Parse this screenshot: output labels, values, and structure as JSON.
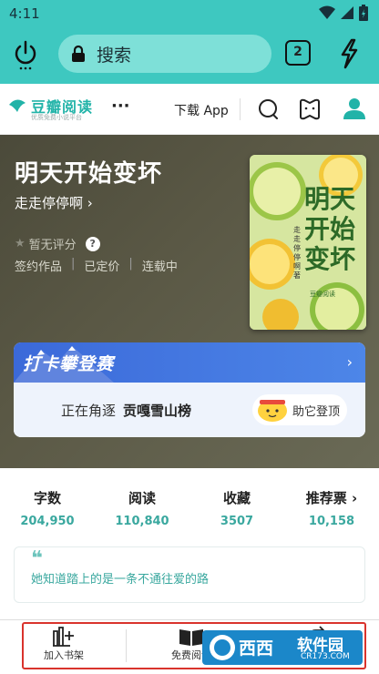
{
  "status": {
    "time": "4:11"
  },
  "browser": {
    "search_placeholder": "搜索",
    "tab_count": "2"
  },
  "site": {
    "logo_name": "豆瓣阅读",
    "logo_sub": "优质免费小说平台",
    "more": "···",
    "download": "下载 App"
  },
  "book": {
    "title": "明天开始变坏",
    "author": "走走停停啊 ›",
    "rating": "暂无评分",
    "tags": [
      "签约作品",
      "已定价",
      "连载中"
    ],
    "cover": {
      "title": "明天开始变坏",
      "author": "走走停停啊 著",
      "brand": "豆瓣阅读"
    }
  },
  "checkin": {
    "banner": "打卡攀登赛",
    "prefix": "正在角逐",
    "rank": "贡嘎雪山榜",
    "boost_button": "助它登顶"
  },
  "stats": [
    {
      "label": "字数",
      "value": "204,950"
    },
    {
      "label": "阅读",
      "value": "110,840"
    },
    {
      "label": "收藏",
      "value": "3507"
    },
    {
      "label": "推荐票 ›",
      "value": "10,158"
    }
  ],
  "quote": {
    "mark": "❝",
    "text": "她知道踏上的是一条不通往爱的路"
  },
  "bottom": {
    "shelf": "加入书架",
    "free_read": "免费阅读",
    "share": "分享"
  },
  "watermark": {
    "text": "软件园",
    "domain": "CR173.COM"
  },
  "colors": {
    "teal": "#3ec8c0",
    "accent": "#3aa89f",
    "banner_blue": "#3b69d9"
  }
}
